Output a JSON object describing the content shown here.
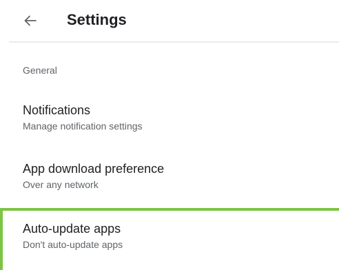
{
  "header": {
    "back_icon": "arrow-back-icon",
    "title": "Settings"
  },
  "section": {
    "label": "General"
  },
  "settings": [
    {
      "title": "Notifications",
      "subtitle": "Manage notification settings"
    },
    {
      "title": "App download preference",
      "subtitle": "Over any network"
    },
    {
      "title": "Auto-update apps",
      "subtitle": "Don't auto-update apps"
    }
  ],
  "colors": {
    "highlight": "#7cc444",
    "divider": "#ebebeb",
    "primary_text": "#202124",
    "secondary_text": "#5f6368"
  }
}
